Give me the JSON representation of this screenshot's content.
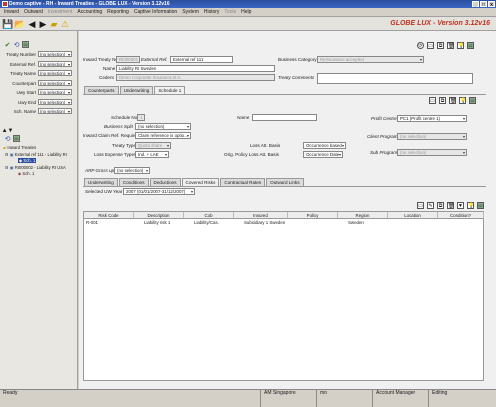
{
  "window": {
    "title": "Demo captive - RH - Inward Treaties - GLOBE LUX - Version 3.12v16",
    "min": "_",
    "max": "□",
    "close": "x"
  },
  "menu": [
    {
      "label": "Inward",
      "disabled": false
    },
    {
      "label": "Outward",
      "disabled": false
    },
    {
      "label": "Investment",
      "disabled": true
    },
    {
      "label": "Accounting",
      "disabled": false
    },
    {
      "label": "Reporting",
      "disabled": false
    },
    {
      "label": "Captive Information",
      "disabled": false
    },
    {
      "label": "System",
      "disabled": false
    },
    {
      "label": "History",
      "disabled": false
    },
    {
      "label": "Tools",
      "disabled": true
    },
    {
      "label": "Help",
      "disabled": false
    }
  ],
  "brand": "GLOBE LUX - Version 3.12v16",
  "filters": [
    {
      "label": "Treaty Number",
      "value": "(no selection)"
    },
    {
      "label": "External Ref.",
      "value": "(no selection)"
    },
    {
      "label": "Treaty Name",
      "value": "(no selection)"
    },
    {
      "label": "Counterpart",
      "value": "(no selection)"
    },
    {
      "label": "Uwy Start",
      "value": "(no selection)"
    },
    {
      "label": "Uwy End",
      "value": "(no selection)"
    },
    {
      "label": "Sch. Name",
      "value": "(no selection)"
    }
  ],
  "tree": {
    "root": "Inward Treaties",
    "n1": "External ref 111 - Liability RI",
    "n1c": "Sch. 1",
    "n2": "RI000002 - Liability RI USA",
    "n2c": "Sch. 1"
  },
  "header": {
    "inward_treaty_no_label": "Inward Treaty No",
    "inward_treaty_no": "RI000001",
    "external_ref_label": "External Ref.",
    "external_ref": "External ref 111",
    "business_category_label": "Business Category",
    "business_category": "Reinsurance accepted",
    "name_label": "Name",
    "name": "Liability RI Sweden",
    "cedent_label": "Cedent",
    "cedent": "Demo Corporate Insurance B.V.",
    "treaty_comments_label": "Treaty Comments"
  },
  "main_tabs": [
    "Counterparts",
    "Underwriting",
    "Schedule 1"
  ],
  "schedule": {
    "schedule_no_label": "Schedule No.",
    "schedule_no": "1",
    "name_label": "Name",
    "business_split_label": "Business Split",
    "business_split": "(no selection)",
    "inward_claim_label": "Inward Claim Ref. Required",
    "inward_claim": "Claim reference is optio...",
    "treaty_type_label": "Treaty Type",
    "treaty_type": "Quota share",
    "loss_expense_label": "Loss Expense Types",
    "loss_expense": "Ind. + LAE",
    "loss_att_label": "Loss Att. Basis",
    "loss_att": "Occurrence based",
    "orig_policy_label": "Orig. Policy Loss Att. Basis",
    "orig_policy": "Occurrence Date",
    "profit_centre_label": "Profit Centre",
    "profit_centre": "PC1 (Profit centre 1)",
    "client_program_label": "Client Program",
    "client_program": "(no selection)",
    "sub_program_label": "Sub Program",
    "sub_program": "(no selection)",
    "arp_label": "ARP Gross up",
    "arp": "(no selection)"
  },
  "sub_tabs": [
    "Underwriting",
    "Conditions",
    "Deductions",
    "Covered Risks",
    "Contractual Rates",
    "Outward Links"
  ],
  "uw_year_label": "Selected UW Year",
  "uw_year": "2007 (01/01/2007-31/12/2007)",
  "grid": {
    "columns": [
      "Risk Code",
      "Description",
      "Cob",
      "Insured",
      "Policy",
      "Region",
      "Location",
      "Condition?"
    ],
    "rows": [
      [
        "R-001",
        "Liability risk 1",
        "Liability/Cas.",
        "Subsidiary 1 Sweden",
        "",
        "Sweden",
        "",
        ""
      ]
    ]
  },
  "status": {
    "left": "Ready",
    "location": "AM Singapore",
    "user": "mo",
    "role": "Account Manager",
    "mode": "Editing"
  }
}
